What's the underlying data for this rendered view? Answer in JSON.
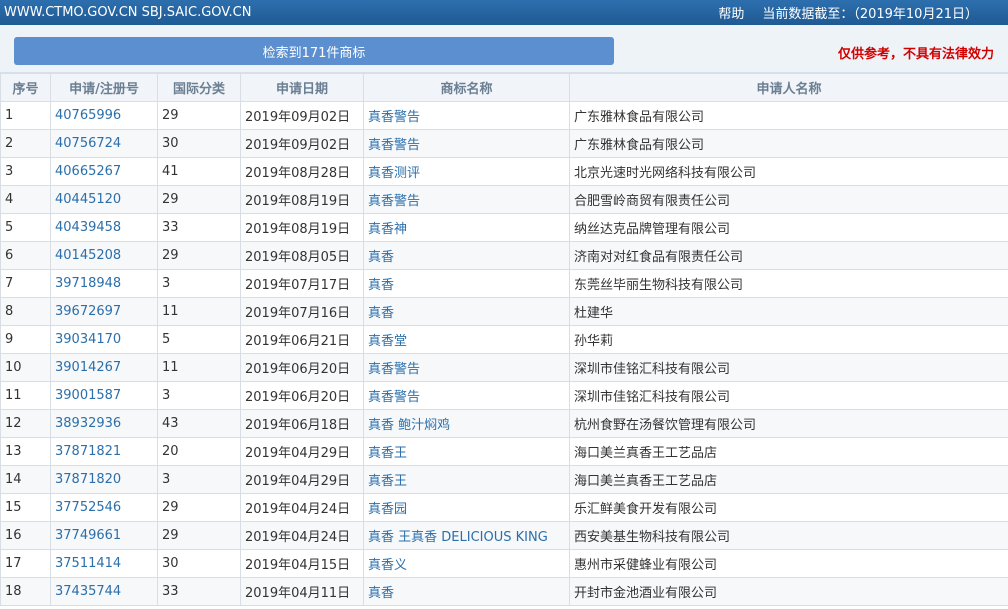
{
  "topbar": {
    "site_links": "WWW.CTMO.GOV.CN SBJ.SAIC.GOV.CN",
    "help": "帮助",
    "data_date": "当前数据截至：（2019年10月21日）"
  },
  "search": {
    "result_label": "检索到171件商标",
    "disclaimer": "仅供参考，不具有法律效力"
  },
  "table": {
    "headers": [
      "序号",
      "申请/注册号",
      "国际分类",
      "申请日期",
      "商标名称",
      "申请人名称"
    ],
    "rows": [
      {
        "no": "1",
        "reg": "40765996",
        "cls": "29",
        "date": "2019年09月02日",
        "name": "真香警告",
        "applicant": "广东雅林食品有限公司"
      },
      {
        "no": "2",
        "reg": "40756724",
        "cls": "30",
        "date": "2019年09月02日",
        "name": "真香警告",
        "applicant": "广东雅林食品有限公司"
      },
      {
        "no": "3",
        "reg": "40665267",
        "cls": "41",
        "date": "2019年08月28日",
        "name": "真香测评",
        "applicant": "北京光速时光网络科技有限公司"
      },
      {
        "no": "4",
        "reg": "40445120",
        "cls": "29",
        "date": "2019年08月19日",
        "name": "真香警告",
        "applicant": "合肥雪岭商贸有限责任公司"
      },
      {
        "no": "5",
        "reg": "40439458",
        "cls": "33",
        "date": "2019年08月19日",
        "name": "真香神",
        "applicant": "纳丝达克品牌管理有限公司"
      },
      {
        "no": "6",
        "reg": "40145208",
        "cls": "29",
        "date": "2019年08月05日",
        "name": "真香",
        "applicant": "济南对对红食品有限责任公司"
      },
      {
        "no": "7",
        "reg": "39718948",
        "cls": "3",
        "date": "2019年07月17日",
        "name": "真香",
        "applicant": "东莞丝毕丽生物科技有限公司"
      },
      {
        "no": "8",
        "reg": "39672697",
        "cls": "11",
        "date": "2019年07月16日",
        "name": "真香",
        "applicant": "杜建华"
      },
      {
        "no": "9",
        "reg": "39034170",
        "cls": "5",
        "date": "2019年06月21日",
        "name": "真香堂",
        "applicant": "孙华莉"
      },
      {
        "no": "10",
        "reg": "39014267",
        "cls": "11",
        "date": "2019年06月20日",
        "name": "真香警告",
        "applicant": "深圳市佳铭汇科技有限公司"
      },
      {
        "no": "11",
        "reg": "39001587",
        "cls": "3",
        "date": "2019年06月20日",
        "name": "真香警告",
        "applicant": "深圳市佳铭汇科技有限公司"
      },
      {
        "no": "12",
        "reg": "38932936",
        "cls": "43",
        "date": "2019年06月18日",
        "name": "真香 鲍汁焖鸡",
        "applicant": "杭州食野在汤餐饮管理有限公司"
      },
      {
        "no": "13",
        "reg": "37871821",
        "cls": "20",
        "date": "2019年04月29日",
        "name": "真香王",
        "applicant": "海口美兰真香王工艺品店"
      },
      {
        "no": "14",
        "reg": "37871820",
        "cls": "3",
        "date": "2019年04月29日",
        "name": "真香王",
        "applicant": "海口美兰真香王工艺品店"
      },
      {
        "no": "15",
        "reg": "37752546",
        "cls": "29",
        "date": "2019年04月24日",
        "name": "真香园",
        "applicant": "乐汇鲜美食开发有限公司"
      },
      {
        "no": "16",
        "reg": "37749661",
        "cls": "29",
        "date": "2019年04月24日",
        "name": "真香 王真香 DELICIOUS KING",
        "applicant": "西安美基生物科技有限公司"
      },
      {
        "no": "17",
        "reg": "37511414",
        "cls": "30",
        "date": "2019年04月15日",
        "name": "真香义",
        "applicant": "惠州市采健蜂业有限公司"
      },
      {
        "no": "18",
        "reg": "37435744",
        "cls": "33",
        "date": "2019年04月11日",
        "name": "真香",
        "applicant": "开封市金池酒业有限公司"
      }
    ]
  }
}
